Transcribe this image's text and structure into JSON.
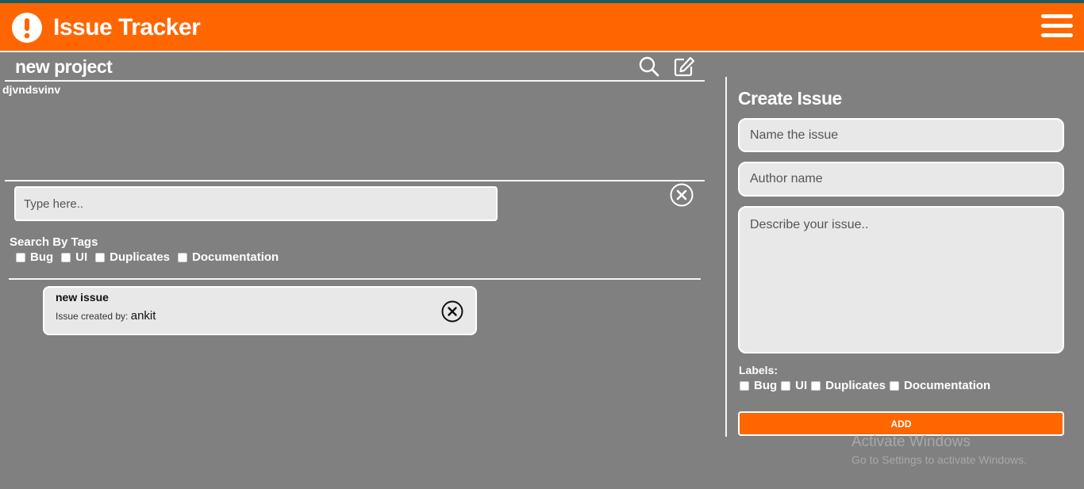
{
  "colors": {
    "header": "#ff6600",
    "background": "#808080",
    "topstrip": "#1d5c63",
    "add_button": "#ff6600"
  },
  "header": {
    "title": "Issue Tracker",
    "logo_icon": "exclamation-circle-icon",
    "menu_icon": "hamburger-menu-icon"
  },
  "project": {
    "name": "new project",
    "description": "djvndsvinv",
    "search_icon": "search-icon",
    "edit_icon": "edit-icon"
  },
  "search": {
    "placeholder": "Type here..",
    "clear_icon": "close-circle-icon"
  },
  "filter": {
    "title": "Search By Tags",
    "tags": [
      "Bug",
      "UI",
      "Duplicates",
      "Documentation"
    ]
  },
  "issues": [
    {
      "title": "new issue",
      "created_by_label": "Issue created by:",
      "author": "ankit",
      "delete_icon": "close-circle-icon"
    }
  ],
  "create_issue": {
    "title": "Create Issue",
    "name_placeholder": "Name the issue",
    "author_placeholder": "Author name",
    "description_placeholder": "Describe your issue..",
    "labels_title": "Labels:",
    "labels": [
      "Bug",
      "UI",
      "Duplicates",
      "Documentation"
    ],
    "add_label": "ADD"
  },
  "watermark": {
    "title": "Activate Windows",
    "subtitle": "Go to Settings to activate Windows."
  }
}
